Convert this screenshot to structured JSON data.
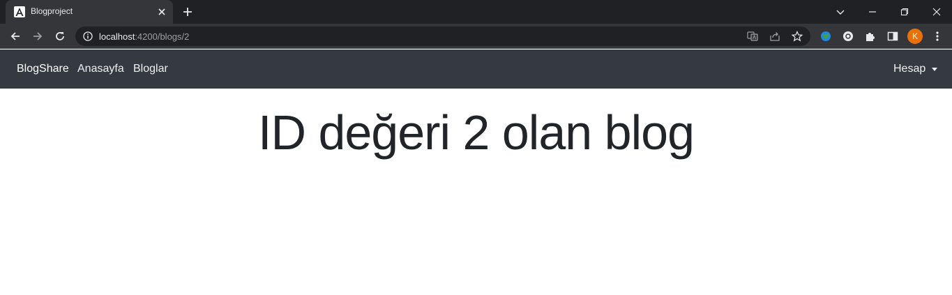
{
  "browser": {
    "tab": {
      "title": "Blogproject",
      "favicon": "angular-icon"
    },
    "address": {
      "host": "localhost",
      "path": ":4200/blogs/2"
    },
    "profile_initial": "K"
  },
  "navbar": {
    "brand": "BlogShare",
    "links": [
      {
        "label": "Anasayfa"
      },
      {
        "label": "Bloglar"
      }
    ],
    "account": {
      "label": "Hesap"
    }
  },
  "main": {
    "heading": "ID değeri 2 olan blog"
  },
  "colors": {
    "navbar_bg": "#343a40",
    "profile_bg": "#e8710a",
    "heading": "#212529"
  }
}
